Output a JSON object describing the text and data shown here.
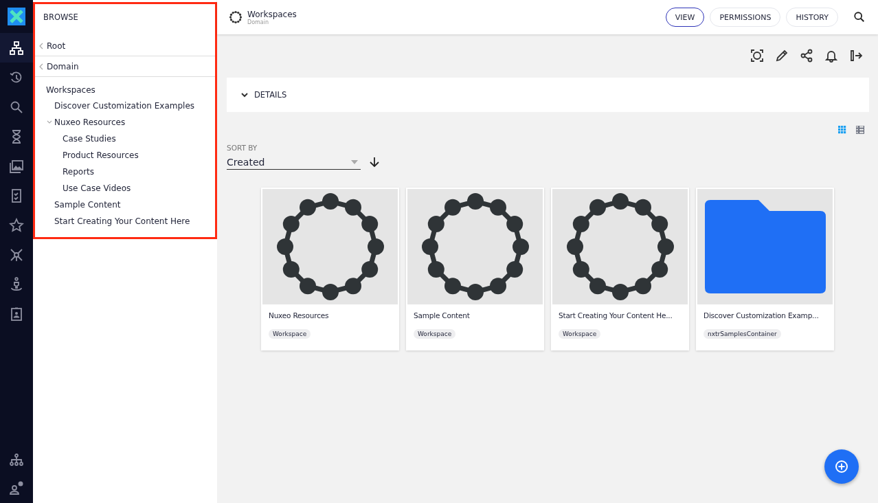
{
  "rail": {
    "items": [
      {
        "kind": "browse",
        "selected": true
      },
      {
        "kind": "history",
        "selected": false
      },
      {
        "kind": "search",
        "selected": false
      },
      {
        "kind": "hourglass",
        "selected": false
      },
      {
        "kind": "gallery",
        "selected": false
      },
      {
        "kind": "tasks",
        "selected": false
      },
      {
        "kind": "star",
        "selected": false
      },
      {
        "kind": "network",
        "selected": false
      },
      {
        "kind": "person-pin",
        "selected": false
      },
      {
        "kind": "badge",
        "selected": false
      }
    ],
    "bottom_items": [
      {
        "kind": "org",
        "selected": false
      },
      {
        "kind": "user-settings",
        "selected": false
      }
    ]
  },
  "browse_panel": {
    "title": "BROWSE",
    "highlighted": true,
    "breadcrumbs": [
      "Root",
      "Domain"
    ],
    "tree": [
      {
        "label": "Workspaces",
        "children": [
          {
            "label": "Discover Customization Examples"
          },
          {
            "label": "Nuxeo Resources",
            "expanded": true,
            "children": [
              {
                "label": "Case Studies"
              },
              {
                "label": "Product Resources"
              },
              {
                "label": "Reports"
              },
              {
                "label": "Use Case Videos"
              }
            ]
          },
          {
            "label": "Sample Content"
          },
          {
            "label": "Start Creating Your Content Here"
          }
        ]
      }
    ]
  },
  "header": {
    "title": "Workspaces",
    "subtitle": "Domain",
    "tabs": [
      {
        "label": "VIEW",
        "selected": true
      },
      {
        "label": "PERMISSIONS",
        "selected": false
      },
      {
        "label": "HISTORY",
        "selected": false
      }
    ]
  },
  "details": {
    "label": "DETAILS",
    "expanded": false
  },
  "view_modes": [
    {
      "kind": "grid",
      "selected": true
    },
    {
      "kind": "list",
      "selected": false
    }
  ],
  "sort": {
    "label": "SORT BY",
    "value": "Created"
  },
  "cards": [
    {
      "title": "Nuxeo Resources",
      "tag": "Workspace",
      "kind": "workspace"
    },
    {
      "title": "Sample Content",
      "tag": "Workspace",
      "kind": "workspace"
    },
    {
      "title": "Start Creating Your Content He...",
      "tag": "Workspace",
      "kind": "workspace"
    },
    {
      "title": "Discover Customization Examp...",
      "tag": "nxtrSamplesContainer",
      "kind": "folder"
    }
  ]
}
